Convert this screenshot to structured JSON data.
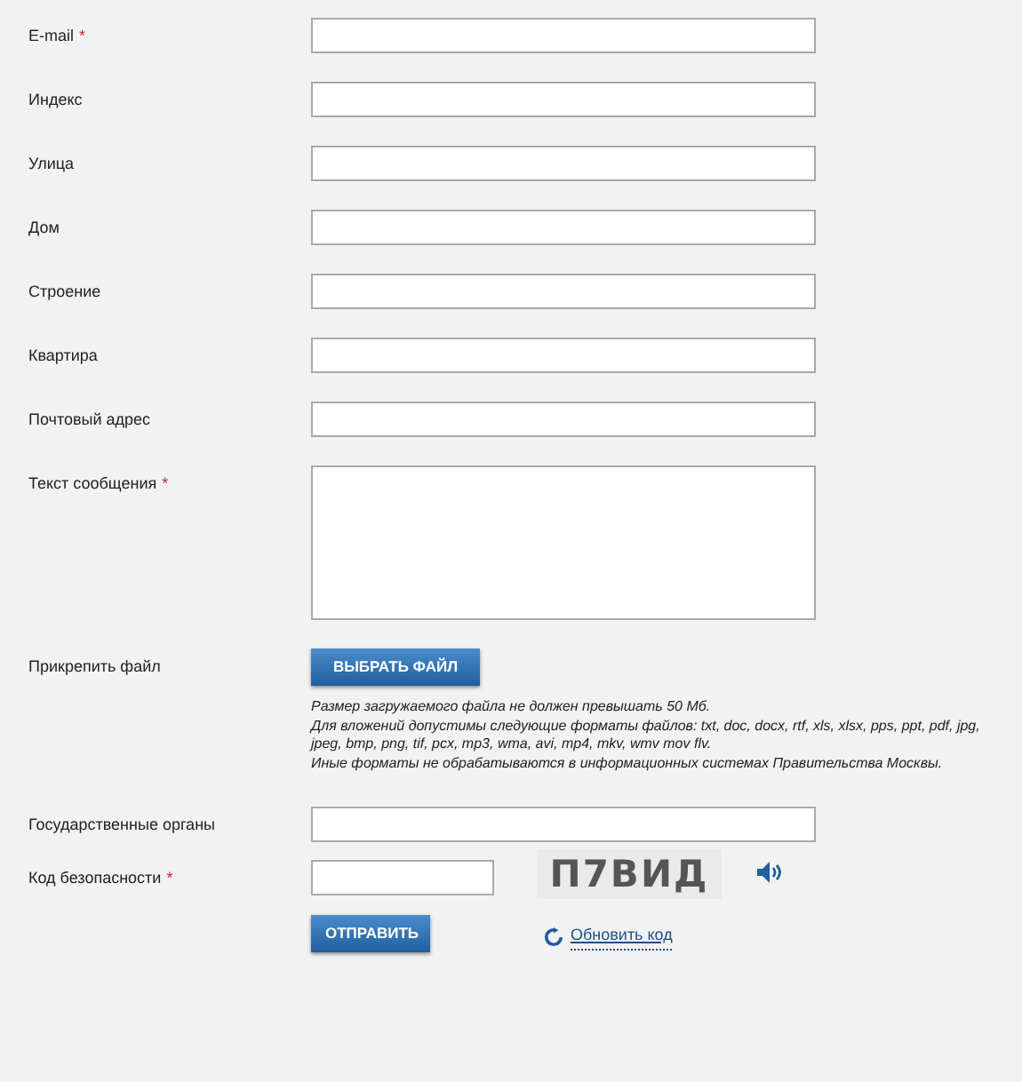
{
  "fields": [
    {
      "kind": "input",
      "label": "E-mail",
      "required_mark": "*"
    },
    {
      "kind": "input",
      "label": "Индекс"
    },
    {
      "kind": "input",
      "label": "Улица"
    },
    {
      "kind": "input",
      "label": "Дом"
    },
    {
      "kind": "input",
      "label": "Строение"
    },
    {
      "kind": "input",
      "label": "Квартира"
    },
    {
      "kind": "input",
      "label": "Почтовый адрес"
    },
    {
      "kind": "textarea",
      "label": "Текст сообщения",
      "required_mark": "*"
    },
    {
      "kind": "file",
      "label": "Прикрепить файл",
      "button": "ВЫБРАТЬ ФАЙЛ",
      "notes": [
        "Размер загружаемого файла не должен превышать 50 Мб.",
        "Для вложений допустимы следующие форматы файлов: txt, doc, docx, rtf, xls, xlsx, pps, ppt, pdf, jpg, jpeg, bmp, png, tif, pcx, mp3, wma, avi, mp4, mkv, wmv mov flv.",
        "Иные форматы не обрабатываются в информационных системах Правительства Москвы."
      ]
    },
    {
      "kind": "input",
      "label": "Государственные органы"
    },
    {
      "kind": "captcha",
      "label": "Код безопасности",
      "required_mark": "*",
      "captcha_text": "П7ВИД",
      "refresh_link": "Обновить код"
    }
  ],
  "submit": "ОТПРАВИТЬ"
}
